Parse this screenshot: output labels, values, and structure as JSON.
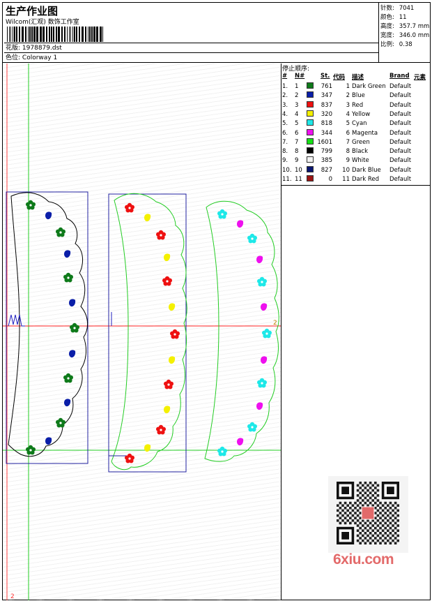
{
  "header": {
    "title": "生产作业图",
    "company": "Wilcom(汇观) 数饰工作室",
    "file_label": "花版:",
    "file_name": "1978879.dst",
    "colorway_label": "色位:",
    "colorway": "Colorway 1"
  },
  "stats": [
    {
      "label": "针数:",
      "value": "7041"
    },
    {
      "label": "颜色:",
      "value": "11"
    },
    {
      "label": "高度:",
      "value": "357.7 mm"
    },
    {
      "label": "宽度:",
      "value": "346.0 mm"
    },
    {
      "label": "比例:",
      "value": "0.38"
    }
  ],
  "stops": {
    "title": "停止顺序:",
    "headers": [
      "#",
      "N#",
      "St.",
      "代码",
      "描述",
      "Brand",
      "元素"
    ],
    "rows": [
      {
        "n": "1.",
        "nn": "1",
        "color": "#0e7a1a",
        "st": "761",
        "code": "1",
        "desc": "Dark Green",
        "brand": "Default"
      },
      {
        "n": "2.",
        "nn": "2",
        "color": "#0a1ea8",
        "st": "347",
        "code": "2",
        "desc": "Blue",
        "brand": "Default"
      },
      {
        "n": "3.",
        "nn": "3",
        "color": "#ee1111",
        "st": "837",
        "code": "3",
        "desc": "Red",
        "brand": "Default"
      },
      {
        "n": "4.",
        "nn": "4",
        "color": "#f4f000",
        "st": "320",
        "code": "4",
        "desc": "Yellow",
        "brand": "Default"
      },
      {
        "n": "5.",
        "nn": "5",
        "color": "#1ee8e8",
        "st": "818",
        "code": "5",
        "desc": "Cyan",
        "brand": "Default"
      },
      {
        "n": "6.",
        "nn": "6",
        "color": "#ee10ee",
        "st": "344",
        "code": "6",
        "desc": "Magenta",
        "brand": "Default"
      },
      {
        "n": "7.",
        "nn": "7",
        "color": "#16e016",
        "st": "1601",
        "code": "7",
        "desc": "Green",
        "brand": "Default"
      },
      {
        "n": "8.",
        "nn": "8",
        "color": "#000000",
        "st": "799",
        "code": "8",
        "desc": "Black",
        "brand": "Default"
      },
      {
        "n": "9.",
        "nn": "9",
        "color": "#f2f2f2",
        "st": "385",
        "code": "9",
        "desc": "White",
        "brand": "Default"
      },
      {
        "n": "10.",
        "nn": "10",
        "color": "#0a1670",
        "st": "827",
        "code": "10",
        "desc": "Dark Blue",
        "brand": "Default"
      },
      {
        "n": "11.",
        "nn": "11",
        "color": "#9a1414",
        "st": "0",
        "code": "11",
        "desc": "Dark Red",
        "brand": "Default"
      }
    ]
  },
  "canvas": {
    "marker_1": "2",
    "marker_2": "2"
  },
  "watermark": "6xiu.com"
}
